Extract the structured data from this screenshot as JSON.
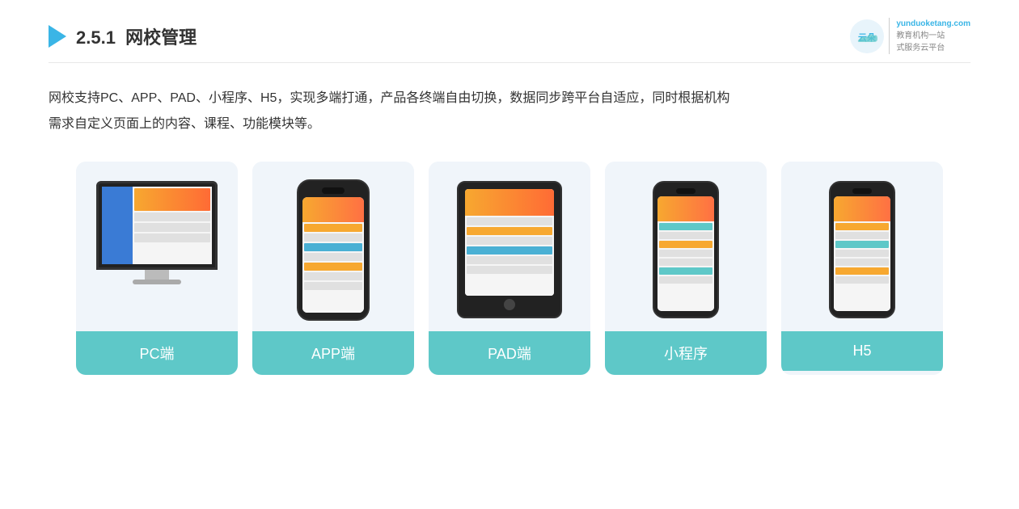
{
  "header": {
    "section_number": "2.5.1",
    "title_plain": "网校管理",
    "brand_name": "云朵课堂",
    "brand_site": "yunduoketang.com",
    "brand_tagline": "教育机构一站\n式服务云平台"
  },
  "description": {
    "line1": "网校支持PC、APP、PAD、小程序、H5，实现多端打通，产品各终端自由切换，数据同步跨平台自适应，同时根据机构",
    "line2": "需求自定义页面上的内容、课程、功能模块等。"
  },
  "cards": [
    {
      "id": "pc",
      "label": "PC端"
    },
    {
      "id": "app",
      "label": "APP端"
    },
    {
      "id": "pad",
      "label": "PAD端"
    },
    {
      "id": "miniapp",
      "label": "小程序"
    },
    {
      "id": "h5",
      "label": "H5"
    }
  ],
  "colors": {
    "accent": "#5ec8c8",
    "header_bg": "#fff",
    "card_bg": "#eef3f8",
    "title_color": "#333"
  }
}
